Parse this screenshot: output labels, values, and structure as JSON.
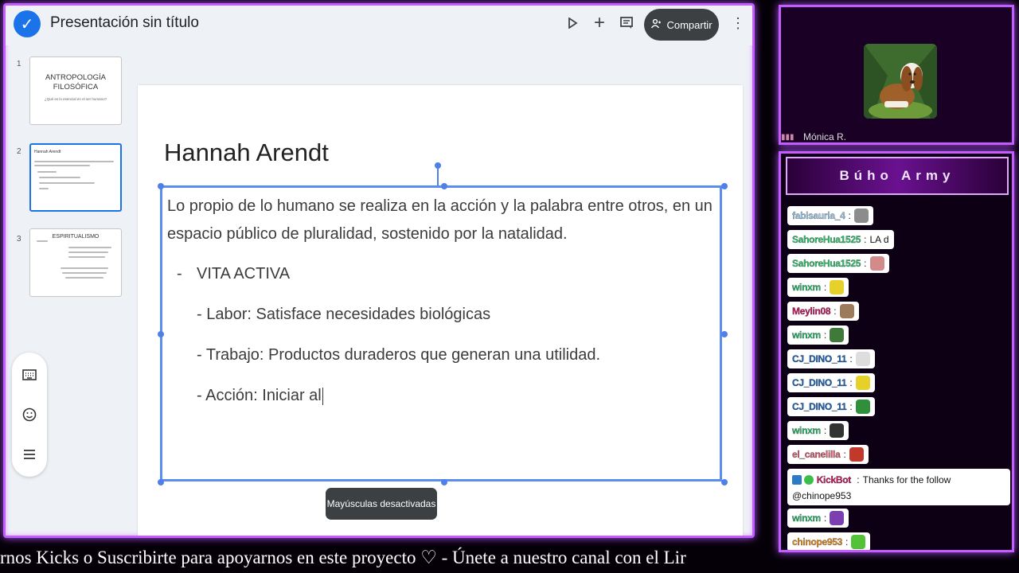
{
  "app": {
    "title": "Presentación sin título",
    "share_label": "Compartir",
    "icons": [
      "check-icon",
      "present-icon",
      "add-icon",
      "comment-icon",
      "share-person-icon",
      "more-vert-icon"
    ]
  },
  "filmstrip": [
    {
      "num": "1",
      "title": "ANTROPOLOGÍA FILOSÓFICA",
      "subtitle": "¿Qué es lo esencial en el ser humano?"
    },
    {
      "num": "2",
      "title": "Hannah Arendt"
    },
    {
      "num": "3",
      "title": "ESPIRITUALISMO"
    }
  ],
  "side_toolbar": {
    "icons": [
      "keyboard-icon",
      "emoji-icon",
      "menu-icon"
    ]
  },
  "slide": {
    "title": "Hannah Arendt",
    "lines": [
      "Lo propio de lo humano se realiza en la acción y la palabra entre otros, en un",
      "espacio público de pluralidad, sostenido por la natalidad.",
      "-",
      "VITA ACTIVA",
      "- Labor: Satisface necesidades biológicas",
      "- Trabajo: Productos duraderos que generan una utilidad.",
      "- Acción: Iniciar al"
    ]
  },
  "toast": "Mayúsculas desactivadas",
  "webcam": {
    "name": "Mónica R."
  },
  "chat": {
    "title": "Búho Army",
    "messages": [
      {
        "user": "fabisauria_4",
        "color": "#9ec7e8",
        "text": "",
        "emote": "#8c8c8c"
      },
      {
        "user": "SahoreHua1525",
        "color": "#2ec26e",
        "text": "LA d",
        "emote": ""
      },
      {
        "user": "SahoreHua1525",
        "color": "#2ec26e",
        "text": "",
        "emote": "#d28a8a"
      },
      {
        "user": "winxm",
        "color": "#27b56a",
        "text": "",
        "emote": "#e6d12a"
      },
      {
        "user": "Meylin08",
        "color": "#c2185b",
        "text": "",
        "emote": "#9c7b5c"
      },
      {
        "user": "winxm",
        "color": "#27b56a",
        "text": "",
        "emote": "#3f7a3a"
      },
      {
        "user": "CJ_DINO_11",
        "color": "#1e63b8",
        "text": "",
        "emote": "#dddddd"
      },
      {
        "user": "CJ_DINO_11",
        "color": "#1e63b8",
        "text": "",
        "emote": "#e6d12a"
      },
      {
        "user": "CJ_DINO_11",
        "color": "#1e63b8",
        "text": "",
        "emote": "#2f8f3a"
      },
      {
        "user": "winxm",
        "color": "#27b56a",
        "text": "",
        "emote": "#333333"
      },
      {
        "user": "el_canelilla",
        "color": "#d65a6e",
        "text": "",
        "emote": "#c0392b"
      }
    ],
    "kickbot": {
      "user": "KickBot",
      "text": "Thanks for the follow",
      "mention": "@chinope953"
    },
    "tail": [
      {
        "user": "winxm",
        "color": "#27b56a",
        "emote": "#7b3fb0"
      },
      {
        "user": "chinope953",
        "color": "#e08a1e",
        "emote": "#53c238"
      }
    ]
  },
  "ticker": "rnos Kicks o Suscribirte para apoyarnos en este proyecto ♡ - Únete a nuestro canal con el Lir"
}
